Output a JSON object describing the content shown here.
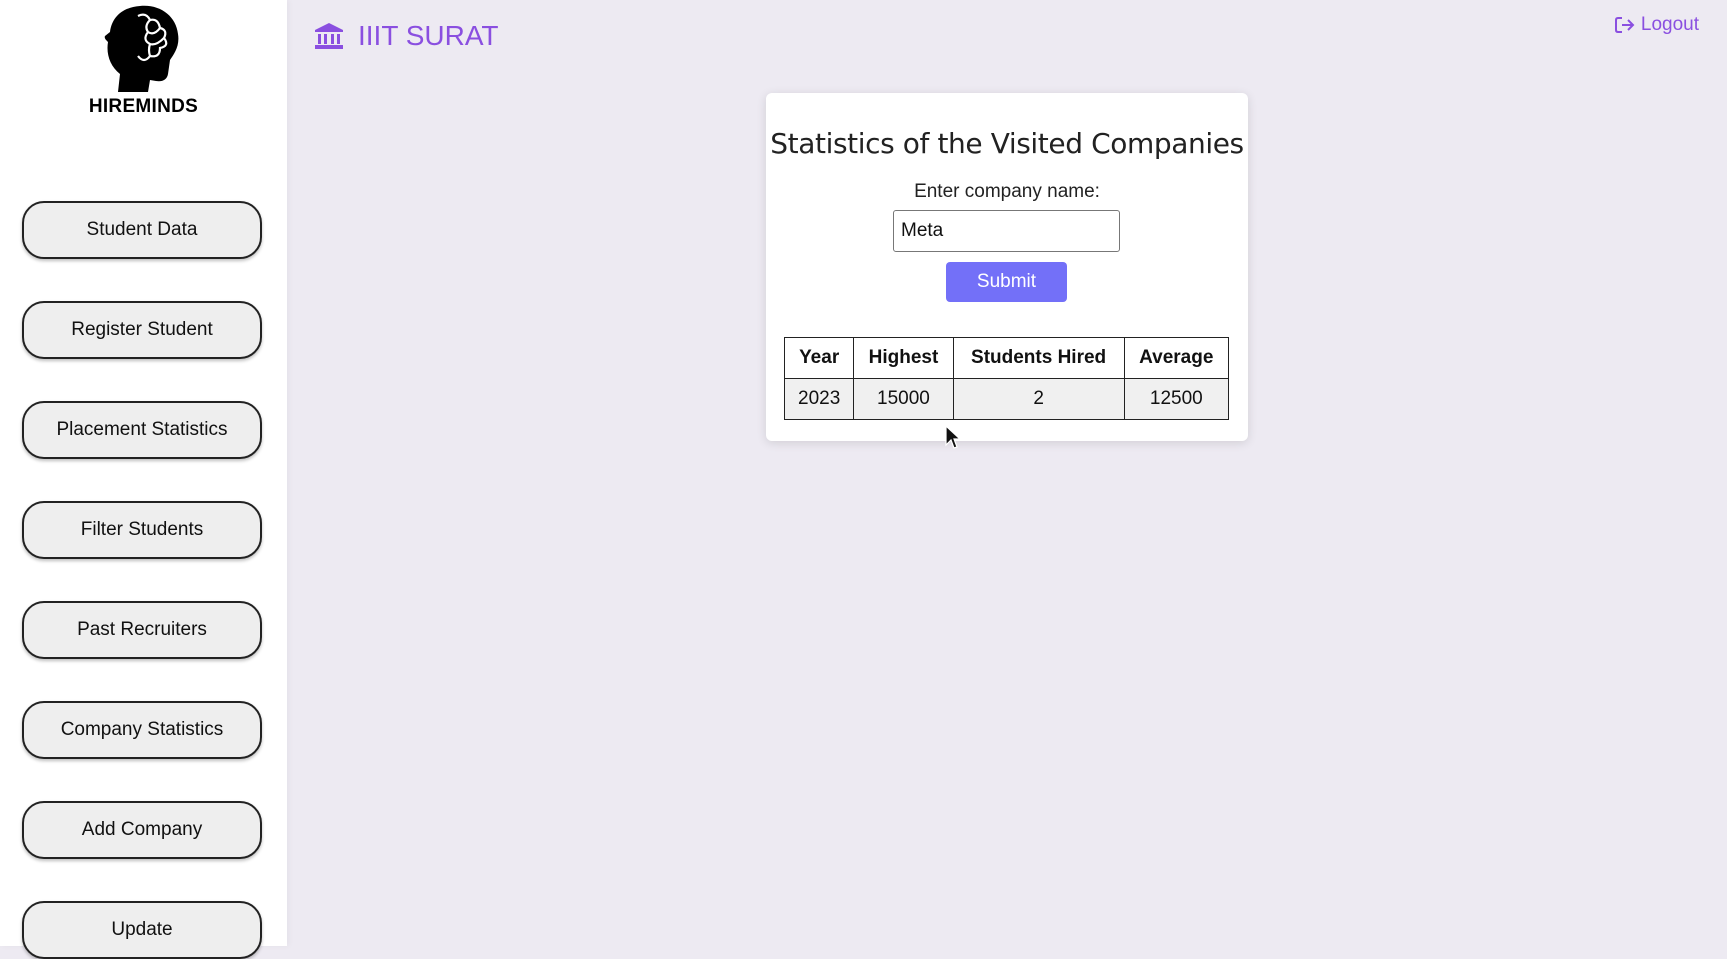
{
  "brand": {
    "logo_text": "HIREMINDS"
  },
  "sidebar": {
    "items": [
      {
        "label": "Student Data"
      },
      {
        "label": "Register Student"
      },
      {
        "label": "Placement Statistics"
      },
      {
        "label": "Filter Students"
      },
      {
        "label": "Past Recruiters"
      },
      {
        "label": "Company Statistics"
      },
      {
        "label": "Add Company"
      },
      {
        "label": "Update"
      }
    ]
  },
  "header": {
    "institute_icon": "bank-icon",
    "institute_name": "IIIT SURAT",
    "logout_icon": "sign-out-icon",
    "logout_label": "Logout"
  },
  "main": {
    "title": "Statistics of the Visited Companies",
    "field_label": "Enter company name:",
    "company_value": "Meta",
    "submit_label": "Submit",
    "table": {
      "headers": [
        "Year",
        "Highest",
        "Students Hired",
        "Average"
      ],
      "rows": [
        [
          "2023",
          "15000",
          "2",
          "12500"
        ]
      ]
    }
  },
  "colors": {
    "accent": "#8a4fe0",
    "submit": "#7370f8",
    "background": "#edeaf2"
  }
}
